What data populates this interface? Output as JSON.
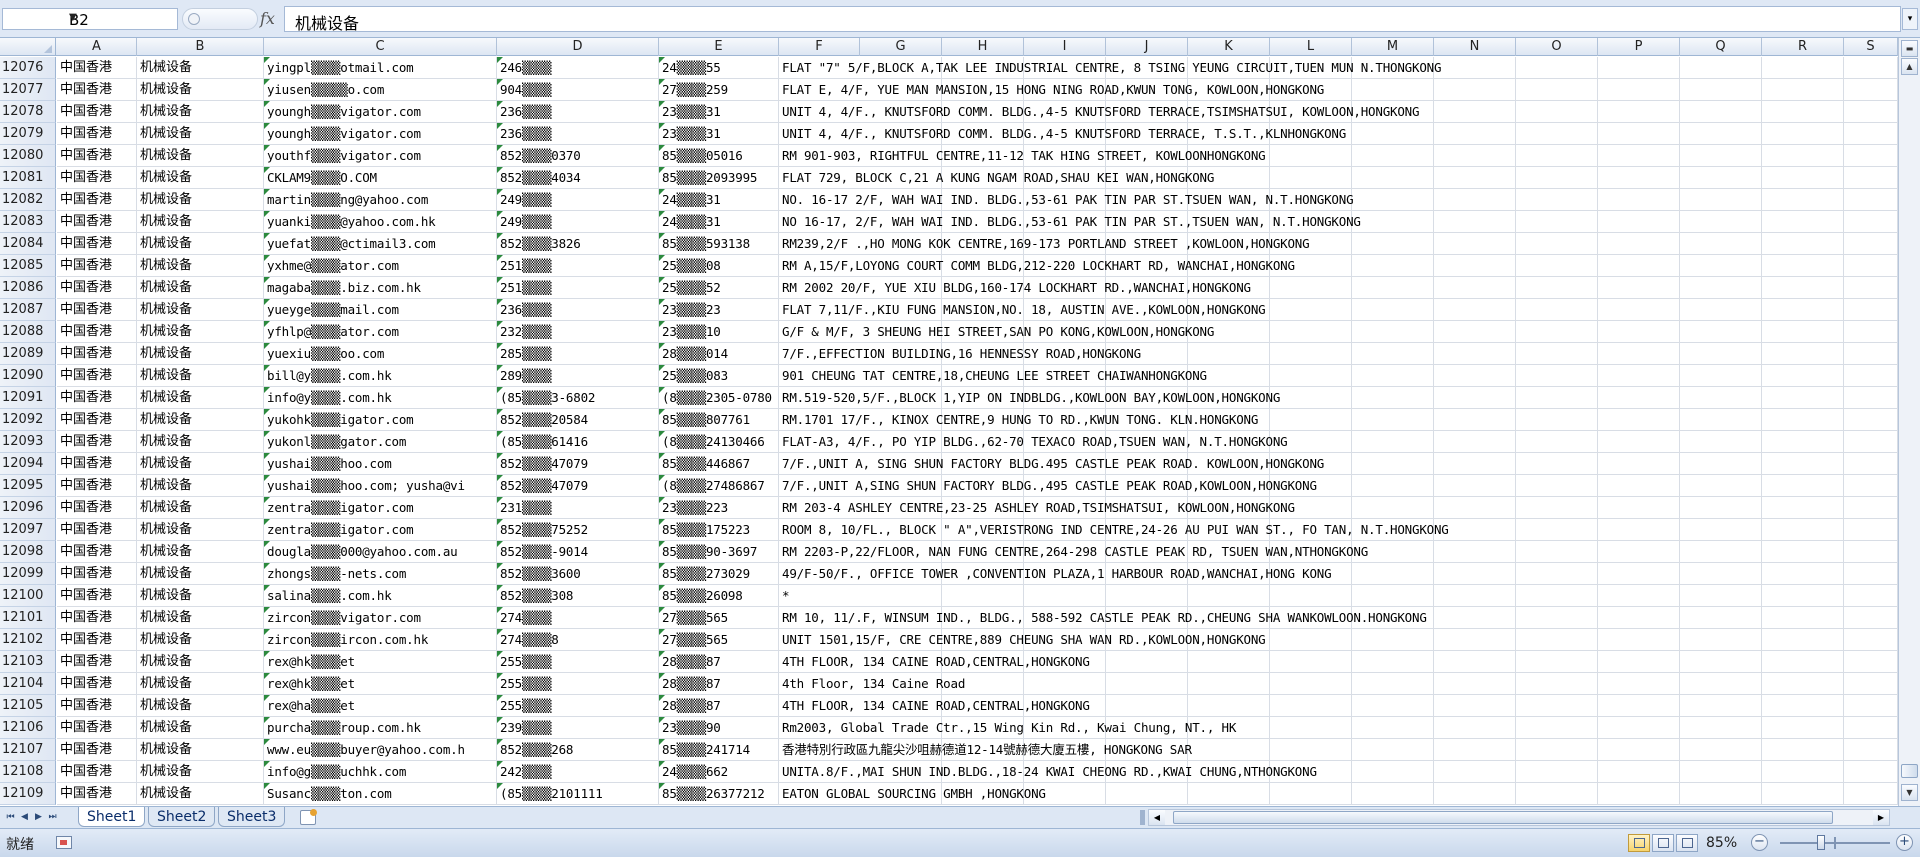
{
  "formula_bar": {
    "name_box": "B2",
    "fx_label": "fx",
    "content": "机械设备"
  },
  "columns": [
    "A",
    "B",
    "C",
    "D",
    "E",
    "F",
    "G",
    "H",
    "I",
    "J",
    "K",
    "L",
    "M",
    "N",
    "O",
    "P",
    "Q",
    "R",
    "S"
  ],
  "rows": [
    {
      "num": "12076",
      "a": "中国香港",
      "b": "机械设备",
      "c": "yingpl▒▒▒▒otmail.com",
      "d": "246▒▒▒▒",
      "e": "24▒▒▒▒55",
      "f": "FLAT \"7\" 5/F,BLOCK A,TAK LEE INDUSTRIAL CENTRE, 8 TSING YEUNG CIRCUIT,TUEN MUN N.THONGKONG"
    },
    {
      "num": "12077",
      "a": "中国香港",
      "b": "机械设备",
      "c": "yiusen▒▒▒▒▒o.com",
      "d": "904▒▒▒▒",
      "e": "27▒▒▒▒259",
      "f": "FLAT E, 4/F, YUE MAN MANSION,15 HONG NING ROAD,KWUN TONG, KOWLOON,HONGKONG"
    },
    {
      "num": "12078",
      "a": "中国香港",
      "b": "机械设备",
      "c": "youngh▒▒▒▒vigator.com",
      "d": "236▒▒▒▒",
      "e": "23▒▒▒▒31",
      "f": "UNIT 4, 4/F., KNUTSFORD COMM. BLDG.,4-5 KNUTSFORD TERRACE,TSIMSHATSUI, KOWLOON,HONGKONG"
    },
    {
      "num": "12079",
      "a": "中国香港",
      "b": "机械设备",
      "c": "youngh▒▒▒▒vigator.com",
      "d": "236▒▒▒▒",
      "e": "23▒▒▒▒31",
      "f": "UNIT 4, 4/F., KNUTSFORD COMM. BLDG.,4-5 KNUTSFORD TERRACE, T.S.T.,KLNHONGKONG"
    },
    {
      "num": "12080",
      "a": "中国香港",
      "b": "机械设备",
      "c": "youthf▒▒▒▒vigator.com",
      "d": "852▒▒▒▒0370",
      "e": "85▒▒▒▒05016",
      "f": "RM 901-903, RIGHTFUL CENTRE,11-12 TAK HING STREET, KOWLOONHONGKONG"
    },
    {
      "num": "12081",
      "a": "中国香港",
      "b": "机械设备",
      "c": "CKLAM9▒▒▒▒O.COM",
      "d": "852▒▒▒▒4034",
      "e": "85▒▒▒▒2093995",
      "f": "FLAT 729, BLOCK C,21 A KUNG NGAM ROAD,SHAU KEI WAN,HONGKONG"
    },
    {
      "num": "12082",
      "a": "中国香港",
      "b": "机械设备",
      "c": "martin▒▒▒▒ng@yahoo.com",
      "d": "249▒▒▒▒",
      "e": "24▒▒▒▒31",
      "f": "NO. 16-17 2/F, WAH WAI IND. BLDG.,53-61 PAK TIN PAR ST.TSUEN WAN, N.T.HONGKONG"
    },
    {
      "num": "12083",
      "a": "中国香港",
      "b": "机械设备",
      "c": "yuanki▒▒▒▒@yahoo.com.hk",
      "d": "249▒▒▒▒",
      "e": "24▒▒▒▒31",
      "f": "NO 16-17, 2/F, WAH WAI IND. BLDG.,53-61 PAK TIN PAR ST.,TSUEN WAN, N.T.HONGKONG"
    },
    {
      "num": "12084",
      "a": "中国香港",
      "b": "机械设备",
      "c": "yuefat▒▒▒▒@ctimail3.com",
      "d": "852▒▒▒▒3826",
      "e": "85▒▒▒▒593138",
      "f": "RM239,2/F .,HO MONG KOK CENTRE,169-173 PORTLAND STREET ,KOWLOON,HONGKONG"
    },
    {
      "num": "12085",
      "a": "中国香港",
      "b": "机械设备",
      "c": "yxhme@▒▒▒▒ator.com",
      "d": "251▒▒▒▒",
      "e": "25▒▒▒▒08",
      "f": "RM A,15/F,LOYONG COURT COMM BLDG,212-220 LOCKHART RD, WANCHAI,HONGKONG"
    },
    {
      "num": "12086",
      "a": "中国香港",
      "b": "机械设备",
      "c": "magaba▒▒▒▒.biz.com.hk",
      "d": "251▒▒▒▒",
      "e": "25▒▒▒▒52",
      "f": "RM 2002 20/F, YUE XIU BLDG,160-174 LOCKHART RD.,WANCHAI,HONGKONG"
    },
    {
      "num": "12087",
      "a": "中国香港",
      "b": "机械设备",
      "c": "yueyge▒▒▒▒mail.com",
      "d": "236▒▒▒▒",
      "e": "23▒▒▒▒23",
      "f": "FLAT 7,11/F.,KIU FUNG MANSION,NO. 18, AUSTIN AVE.,KOWLOON,HONGKONG"
    },
    {
      "num": "12088",
      "a": "中国香港",
      "b": "机械设备",
      "c": "yfhlp@▒▒▒▒ator.com",
      "d": "232▒▒▒▒",
      "e": "23▒▒▒▒10",
      "f": "G/F & M/F, 3 SHEUNG HEI STREET,SAN PO KONG,KOWLOON,HONGKONG"
    },
    {
      "num": "12089",
      "a": "中国香港",
      "b": "机械设备",
      "c": "yuexiu▒▒▒▒oo.com",
      "d": "285▒▒▒▒",
      "e": "28▒▒▒▒014",
      "f": "7/F.,EFFECTION BUILDING,16 HENNESSY ROAD,HONGKONG"
    },
    {
      "num": "12090",
      "a": "中国香港",
      "b": "机械设备",
      "c": "bill@y▒▒▒▒.com.hk",
      "d": "289▒▒▒▒",
      "e": "25▒▒▒▒083",
      "f": "901 CHEUNG TAT CENTRE,18,CHEUNG LEE STREET CHAIWANHONGKONG"
    },
    {
      "num": "12091",
      "a": "中国香港",
      "b": "机械设备",
      "c": "info@y▒▒▒▒.com.hk",
      "d": "(85▒▒▒▒3-6802",
      "e": "(8▒▒▒▒2305-0780",
      "f": "RM.519-520,5/F.,BLOCK 1,YIP ON INDBLDG.,KOWLOON BAY,KOWLOON,HONGKONG"
    },
    {
      "num": "12092",
      "a": "中国香港",
      "b": "机械设备",
      "c": "yukohk▒▒▒▒igator.com",
      "d": "852▒▒▒▒20584",
      "e": "85▒▒▒▒807761",
      "f": "RM.1701 17/F., KINOX CENTRE,9 HUNG TO RD.,KWUN TONG. KLN.HONGKONG"
    },
    {
      "num": "12093",
      "a": "中国香港",
      "b": "机械设备",
      "c": "yukonl▒▒▒▒gator.com",
      "d": "(85▒▒▒▒61416",
      "e": "(8▒▒▒▒24130466",
      "f": "FLAT-A3, 4/F., PO YIP BLDG.,62-70 TEXACO ROAD,TSUEN WAN, N.T.HONGKONG"
    },
    {
      "num": "12094",
      "a": "中国香港",
      "b": "机械设备",
      "c": "yushai▒▒▒▒hoo.com",
      "d": "852▒▒▒▒47079",
      "e": "85▒▒▒▒446867",
      "f": "7/F.,UNIT A, SING SHUN FACTORY BLDG.495 CASTLE PEAK ROAD.    KOWLOON,HONGKONG"
    },
    {
      "num": "12095",
      "a": "中国香港",
      "b": "机械设备",
      "c": "yushai▒▒▒▒hoo.com; yusha@vi",
      "d": "852▒▒▒▒47079",
      "e": "(8▒▒▒▒27486867",
      "f": "7/F.,UNIT A,SING SHUN FACTORY BLDG.,495 CASTLE PEAK ROAD,KOWLOON,HONGKONG"
    },
    {
      "num": "12096",
      "a": "中国香港",
      "b": "机械设备",
      "c": "zentra▒▒▒▒igator.com",
      "d": "231▒▒▒▒",
      "e": "23▒▒▒▒223",
      "f": "RM 203-4 ASHLEY CENTRE,23-25 ASHLEY ROAD,TSIMSHATSUI, KOWLOON,HONGKONG"
    },
    {
      "num": "12097",
      "a": "中国香港",
      "b": "机械设备",
      "c": "zentra▒▒▒▒igator.com",
      "d": "852▒▒▒▒75252",
      "e": "85▒▒▒▒175223",
      "f": "ROOM 8, 10/FL., BLOCK \" A\",VERISTRONG IND CENTRE,24-26 AU PUI WAN ST., FO TAN, N.T.HONGKONG"
    },
    {
      "num": "12098",
      "a": "中国香港",
      "b": "机械设备",
      "c": "dougla▒▒▒▒000@yahoo.com.au",
      "d": "852▒▒▒▒-9014",
      "e": "85▒▒▒▒90-3697",
      "f": "RM 2203-P,22/FLOOR, NAN FUNG CENTRE,264-298 CASTLE PEAK RD, TSUEN WAN,NTHONGKONG"
    },
    {
      "num": "12099",
      "a": "中国香港",
      "b": "机械设备",
      "c": "zhongs▒▒▒▒-nets.com",
      "d": "852▒▒▒▒3600",
      "e": "85▒▒▒▒273029",
      "f": "49/F-50/F., OFFICE TOWER ,CONVENTION PLAZA,1 HARBOUR ROAD,WANCHAI,HONG KONG"
    },
    {
      "num": "12100",
      "a": "中国香港",
      "b": "机械设备",
      "c": "salina▒▒▒▒.com.hk",
      "d": "852▒▒▒▒308",
      "e": "85▒▒▒▒26098",
      "f": "*"
    },
    {
      "num": "12101",
      "a": "中国香港",
      "b": "机械设备",
      "c": "zircon▒▒▒▒vigator.com",
      "d": "274▒▒▒▒",
      "e": "27▒▒▒▒565",
      "f": "RM 10, 11/.F, WINSUM IND., BLDG., 588-592 CASTLE PEAK RD.,CHEUNG SHA WANKOWLOON.HONGKONG"
    },
    {
      "num": "12102",
      "a": "中国香港",
      "b": "机械设备",
      "c": "zircon▒▒▒▒ircon.com.hk",
      "d": "274▒▒▒▒8",
      "e": "27▒▒▒▒565",
      "f": "UNIT 1501,15/F, CRE CENTRE,889 CHEUNG SHA WAN RD.,KOWLOON,HONGKONG"
    },
    {
      "num": "12103",
      "a": "中国香港",
      "b": "机械设备",
      "c": "rex@hk▒▒▒▒et",
      "d": "255▒▒▒▒",
      "e": "28▒▒▒▒87",
      "f": "4TH FLOOR, 134 CAINE ROAD,CENTRAL,HONGKONG"
    },
    {
      "num": "12104",
      "a": "中国香港",
      "b": "机械设备",
      "c": "rex@hk▒▒▒▒et",
      "d": "255▒▒▒▒",
      "e": "28▒▒▒▒87",
      "f": "4th Floor, 134 Caine Road"
    },
    {
      "num": "12105",
      "a": "中国香港",
      "b": "机械设备",
      "c": "rex@ha▒▒▒▒et",
      "d": "255▒▒▒▒",
      "e": "28▒▒▒▒87",
      "f": "4TH FLOOR, 134 CAINE ROAD,CENTRAL,HONGKONG"
    },
    {
      "num": "12106",
      "a": "中国香港",
      "b": "机械设备",
      "c": "purcha▒▒▒▒roup.com.hk",
      "d": "239▒▒▒▒",
      "e": "23▒▒▒▒90",
      "f": "Rm2003, Global Trade Ctr.,15 Wing Kin Rd., Kwai Chung, NT., HK"
    },
    {
      "num": "12107",
      "a": "中国香港",
      "b": "机械设备",
      "c": "www.eu▒▒▒▒buyer@yahoo.com.h",
      "d": "852▒▒▒▒268",
      "e": "85▒▒▒▒241714",
      "f": "香港特別行政區九龍尖沙咀赫德道12-14號赫德大廈五樓, HONGKONG SAR"
    },
    {
      "num": "12108",
      "a": "中国香港",
      "b": "机械设备",
      "c": "info@g▒▒▒▒uchhk.com",
      "d": "242▒▒▒▒",
      "e": "24▒▒▒▒662",
      "f": "UNITA.8/F.,MAI SHUN IND.BLDG.,18-24 KWAI CHEONG RD.,KWAI CHUNG,NTHONGKONG"
    },
    {
      "num": "12109",
      "a": "中国香港",
      "b": "机械设备",
      "c": "Susanc▒▒▒▒ton.com",
      "d": "(85▒▒▒▒2101111",
      "e": "85▒▒▒▒26377212",
      "f": "EATON GLOBAL SOURCING GMBH ,HONGKONG"
    }
  ],
  "sheet_tabs": [
    "Sheet1",
    "Sheet2",
    "Sheet3"
  ],
  "status": {
    "ready_text": "就绪",
    "zoom": "85%",
    "zoom_minus": "−",
    "zoom_plus": "+"
  }
}
